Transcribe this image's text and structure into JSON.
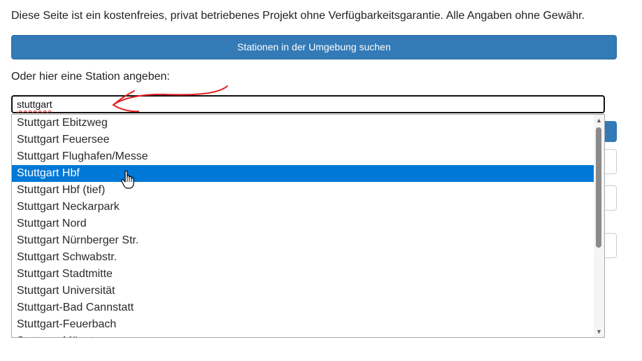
{
  "disclaimer": "Diese Seite ist ein kostenfreies, privat betriebenes Projekt ohne Verfügbarkeitsgarantie. Alle Angaben ohne Gewähr.",
  "nearby_button_label": "Stationen in der Umgebung suchen",
  "station_label": "Oder hier eine Station angeben:",
  "search": {
    "value": "stuttgart"
  },
  "dropdown": {
    "selected_index": 3,
    "options": [
      "Stuttgart Ebitzweg",
      "Stuttgart Feuersee",
      "Stuttgart Flughafen/Messe",
      "Stuttgart Hbf",
      "Stuttgart Hbf (tief)",
      "Stuttgart Neckarpark",
      "Stuttgart Nord",
      "Stuttgart Nürnberger Str.",
      "Stuttgart Schwabstr.",
      "Stuttgart Stadtmitte",
      "Stuttgart Universität",
      "Stuttgart-Bad Cannstatt",
      "Stuttgart-Feuerbach",
      "Stuttgart-Münster"
    ]
  },
  "colors": {
    "primary": "#337ab7",
    "selection": "#0078d7",
    "annotation": "#e02020"
  },
  "icons": {
    "cursor": "hand-pointer-icon",
    "scroll_up": "scroll-up-arrow-icon",
    "scroll_down": "scroll-down-arrow-icon",
    "annotation": "red-arrow-annotation"
  }
}
